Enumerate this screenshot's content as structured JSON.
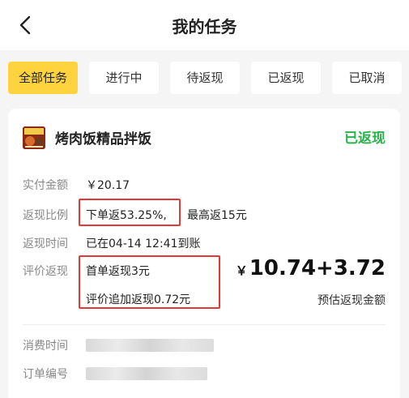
{
  "header": {
    "title": "我的任务",
    "back_icon": "chevron-left-icon"
  },
  "tabs": [
    {
      "label": "全部任务",
      "active": true
    },
    {
      "label": "进行中",
      "active": false
    },
    {
      "label": "待返现",
      "active": false
    },
    {
      "label": "已返现",
      "active": false
    },
    {
      "label": "已取消",
      "active": false
    }
  ],
  "order": {
    "shop_name": "烤肉饭精品拌饭",
    "status": "已返现",
    "paid_label": "实付金额",
    "paid_value": "￥20.17",
    "ratio_label": "返现比例",
    "ratio_value": "下单返53.25%,",
    "ratio_max": "最高返15元",
    "time_label": "返现时间",
    "time_value": "已在04-14 12:41到账",
    "review_label": "评价返现",
    "review_first": "首单返现3元",
    "review_extra": "评价追加返现0.72元",
    "amount_symbol": "￥",
    "amount_value": "10.74+3.72",
    "amount_caption": "预估返现金额",
    "consume_label": "消费时间",
    "order_no_label": "订单编号"
  },
  "colors": {
    "accent": "#ffd33d",
    "status_green": "#2cb24a",
    "highlight_red": "#e53935"
  }
}
